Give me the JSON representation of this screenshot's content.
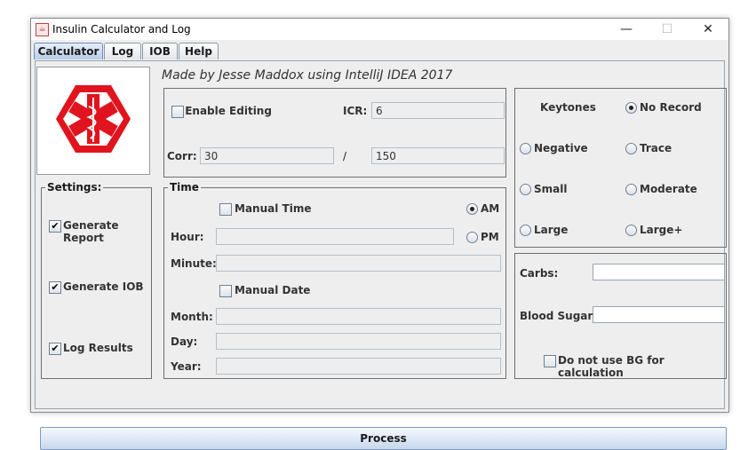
{
  "window": {
    "title": "Insulin Calculator and Log",
    "minimize": "—",
    "maximize": "☐",
    "close": "✕"
  },
  "tabs": [
    "Calculator",
    "Log",
    "IOB",
    "Help"
  ],
  "credit": "Made by Jesse Maddox using IntelliJ IDEA 2017",
  "editing": {
    "enable_label": "Enable Editing",
    "icr_label": "ICR:",
    "icr_value": "6",
    "corr_label": "Corr:",
    "corr_value": "30",
    "slash": "/",
    "corr_divisor": "150"
  },
  "ketones": {
    "title": "Keytones",
    "options": [
      "No Record",
      "Negative",
      "Trace",
      "Small",
      "Moderate",
      "Large",
      "Large+"
    ],
    "selected": "No Record"
  },
  "settings": {
    "title": "Settings:",
    "generate_report": "Generate Report",
    "generate_iob": "Generate IOB",
    "log_results": "Log Results"
  },
  "time": {
    "title": "Time",
    "manual_time": "Manual Time",
    "am": "AM",
    "pm": "PM",
    "hour": "Hour:",
    "minute": "Minute:",
    "manual_date": "Manual Date",
    "month": "Month:",
    "day": "Day:",
    "year": "Year:"
  },
  "input": {
    "carbs": "Carbs:",
    "blood_sugar": "Blood Sugar:",
    "no_bg": "Do not use BG for calculation"
  },
  "process": "Process",
  "colors": {
    "logo_red": "#e0141e",
    "tab_active": "#b9cde9",
    "button_accent": "#c7d7ee"
  }
}
